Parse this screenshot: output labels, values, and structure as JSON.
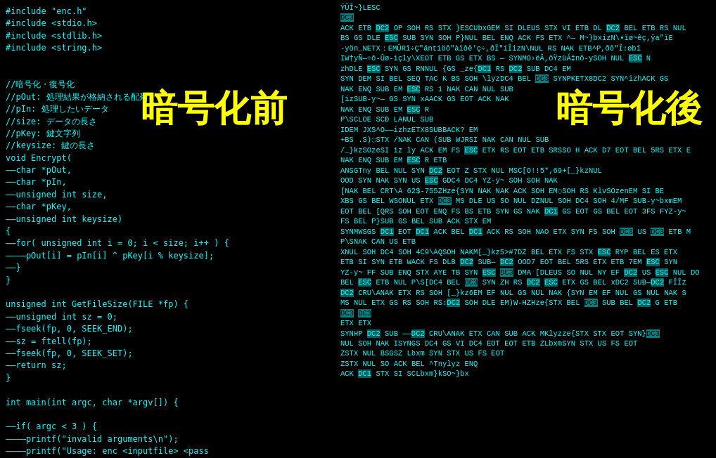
{
  "left": {
    "label": "暗号化前",
    "code_lines": [
      "#include \"enc.h\"",
      "#include <stdio.h>",
      "#include <stdlib.h>",
      "#include <string.h>",
      "",
      "",
      "//暗号化・復号化",
      "//pOut: 処理結果が格納される配列",
      "//pIn: 処理したいデータ",
      "//size: データの長さ",
      "//pKey: 鍵文字列",
      "//keysize: 鍵の長さ",
      "void Encrypt(",
      "——char *pOut,",
      "——char *pIn,",
      "——unsigned int size,",
      "——char *pKey,",
      "——unsigned int keysize)",
      "{",
      "——for( unsigned int i = 0; i < size; i++ ) {",
      "————pOut[i] = pIn[i] ^ pKey[i % keysize];",
      "——}",
      "}",
      "",
      "unsigned int GetFileSize(FILE *fp) {",
      "——unsigned int sz = 0;",
      "——fseek(fp, 0, SEEK_END);",
      "——sz = ftell(fp);",
      "——fseek(fp, 0, SEEK_SET);",
      "——return sz;",
      "}",
      "",
      "int main(int argc, char *argv[]) {",
      "",
      "——if( argc < 3 ) {",
      "————printf(\"invalid arguments\\n\");",
      "————printf(\"Usage: enc <inputfile> <pass"
    ]
  },
  "right": {
    "label": "暗号化後",
    "binary_text": "ŸÛÎ~}LESC\nDC3\nACK ETB DC2 OP SOH RS STX }ESCUbxGEM SI DLEUS STX VI ETB DL DC2 BEL ETB RS NUL\nBS GS DLE ESC SUB SYN SOH P}NUL BEL ENQ ACK FS ETX ^— M~}bxizN\\•ïø~êç,ÿa\"ïE\n-yön_NETX：EMÛRî÷Ç\"äntiöô\"àïôë'ç÷,ðÏ\"íÎizN\\NUL RS NAK ETB^P,ðô\"Î↕øbï\nIW†yÑ—÷ô-Ûø-içly\\XEOT ETB GS ETX BS — SYNMO›ëÂ,öŸzùÁ‡nô-ySOH NUL ESC N\nzhDLE ESC SYN GS RNNUL {GS _ze{DC1 RS DC2 SUB DC4 EM\nSYN DEM SI BEL SEQ TAC K BS SOH \\lyzDC4 BEL DC3 SYNPKETX8DC2 SYN^izhACK GS\nNAK ENQ SUB EM ESC RS 1 NAK CAN NUL SUB\n[izSUB-y~— GS SYN xAACK GS EOT ACK NAK\nNAK ENQ SUB EM ESC R\nP\\SCLOE SCÐ LANUL SUB\nIDEM JXS^O——izhzETX8SUBBACK? EM <SNwUS;\n+BS .S)◌STX /NAK CAN (SUB WJRSI NAK CAN NUL SUB\n/_}kzSOzeSI iz ly ACK EM FS ESC ETX RS EOT ETB SRSSO H ACK D7 EOT BEL 5RS ETX E\nNAK ENQ SUB EM ESC R ETB\nANSGTny BEL NUL SYN DC2 EOT Z STX NUL MSC[O!!5*,69+[_}kzNUL\nOOD SYN NAK SYN US ESC GDC4 DC4 YZ-y~ SOH SOH NAK\n[NAK BEL CRT\\A 62$-755ZHze{SYN NAK NAK ACK SOH EM◌SOH RS KlvSOzenEM SI BE\nXBS GS BEL WSONUL ETX DC3 MS DLE US SO NUL DZNUL SOH DC4 SOH 4/MF SUB-y~bxmEM\nEOT BEL [QRS SOH EOT ENQ FS BS ETB SYN GS NAK DC1 GS EOT GS BEL EOT 3FS FYZ-y~\nFS BEL P}SUB GS BEL SUB ACK STX EM\nSYNMWSGS DC1 EOT DC1 ACK BEL DC1 ACK RS SOH NAO ETX SYN FS SOH DC3 US DC3 ETB M\nP\\SNAK CAN US ETB\nXNUL SOH DC4 SOH 4C9\\AQSOH NAKM[_}kz5>#7DZ BEL ETX FS STX ESC RYP BEL ES ETX\nETB SI SYN ETB WACK FS DLB DC2 SUB— DC2 OOD7 EOT BEL 5RS ETX ETB 7EM ESC SYN\nYZ-y~ FF SUB ENQ STX AYE TB SYN ESC DC3 DMA [DLEUS SO NUL NY EF DC2 US ESC NUL DO\nBEL ESC ETB NUL P\\S[DC4 BEL DC3 SYN ZH RS DC2 ESC ETX GS BEL xDC2 SUB—DC2 FÎÎz\nDC2 CRU\\ANAK ETX RS SOH [_}kz6EM EF NUL GS NUL NAK {SYN EM EF NUL GS NUL NAK S\nMS NUL ETX GS RS SOH RS↕DC2 SOH DLE EM)W-HZHze{STX BEL DC3 SUB BEL DC2 G ETB\nDC3 DC3\nETX ETX\nSYNHP DC2 SUB ——DC2 CRU\\ANAK ETX CAN SUB ACK MKlyzze{STX STX EOT SYN}DC3\nNUL SOH NAK ISYNGS DC4 GS VI DC4 EOT EOT ETB ZLbxmSYN STX US FS EOT\nZSTX NUL BSGSZ Lbxm SYN STX US FS EOT\nZSTX NUL SO ACK BEL ^Tnylyz ENQ\nACK DC1 STX SI SCLbxm}kSO~}bx"
  }
}
